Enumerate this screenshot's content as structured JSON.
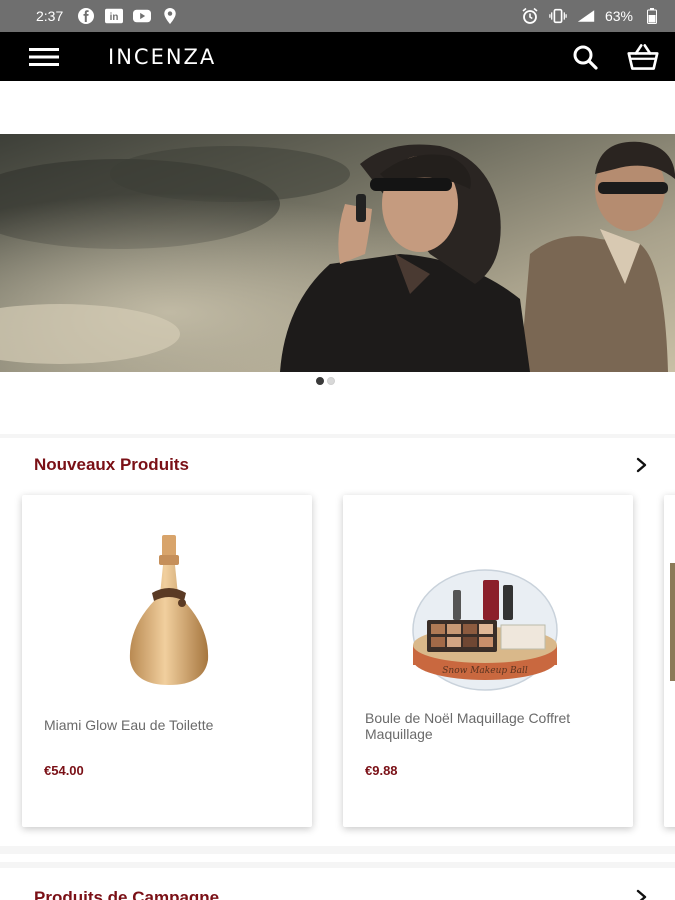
{
  "status_bar": {
    "time": "2:37",
    "battery": "63%",
    "left_icons": [
      "facebook-icon",
      "linkedin-icon",
      "youtube-icon",
      "location-icon"
    ],
    "right_icons": [
      "alarm-icon",
      "vibrate-icon",
      "wifi-icon",
      "signal-icon",
      "battery-icon"
    ]
  },
  "app_bar": {
    "brand": "INCENZA",
    "menu_icon": "hamburger-menu-icon",
    "search_icon": "search-icon",
    "cart_icon": "basket-icon"
  },
  "banner": {
    "slides": 2,
    "active_slide": 1
  },
  "sections": [
    {
      "title": "Nouveaux Produits",
      "products": [
        {
          "name": "Miami Glow Eau de Toilette",
          "price": "€54.00"
        },
        {
          "name": "Boule de Noël Maquillage Coffret Maquillage",
          "price": "€9.88"
        }
      ]
    },
    {
      "title": "Produits de Campagne"
    }
  ],
  "colors": {
    "accent": "#7a1016",
    "appbar": "#000000",
    "statusbar": "#6f6f6f"
  }
}
